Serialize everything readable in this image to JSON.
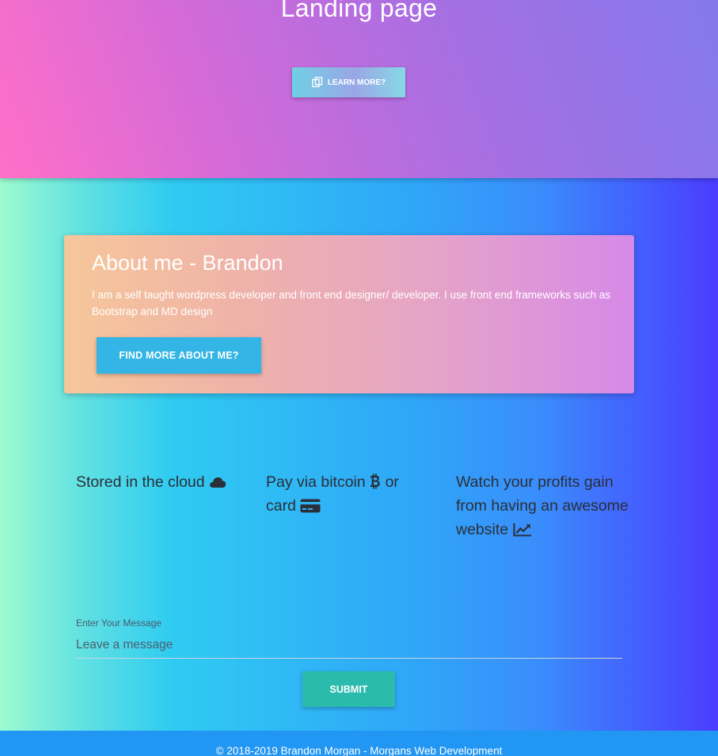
{
  "hero": {
    "title": "Landing page",
    "learn_more_label": "LEARN MORE?",
    "learn_more_icon": "copy-icon"
  },
  "about": {
    "title": "About me - Brandon",
    "text": "I am a self taught wordpress developer and front end designer/ developer. I use front end frameworks such as Bootstrap and MD design",
    "button_label": "FIND MORE ABOUT ME?"
  },
  "features": [
    {
      "text": "Stored in the cloud",
      "icon": "cloud-icon"
    },
    {
      "text": "Pay via bitcoin",
      "text2": "or card",
      "icon": "bitcoin-icon",
      "icon2": "credit-card-icon"
    },
    {
      "text": "Watch your profits gain from having an awesome website",
      "icon": "line-chart-icon"
    }
  ],
  "contact": {
    "label": "Enter Your Message",
    "placeholder": "Leave a message",
    "value": "",
    "submit_label": "SUBMIT"
  },
  "footer": {
    "text": "© 2018-2019 Brandon Morgan - Morgans Web Development"
  },
  "colors": {
    "find_button": "#33b5e5",
    "submit_button": "#2bbbad",
    "footer": "#2196f3"
  }
}
